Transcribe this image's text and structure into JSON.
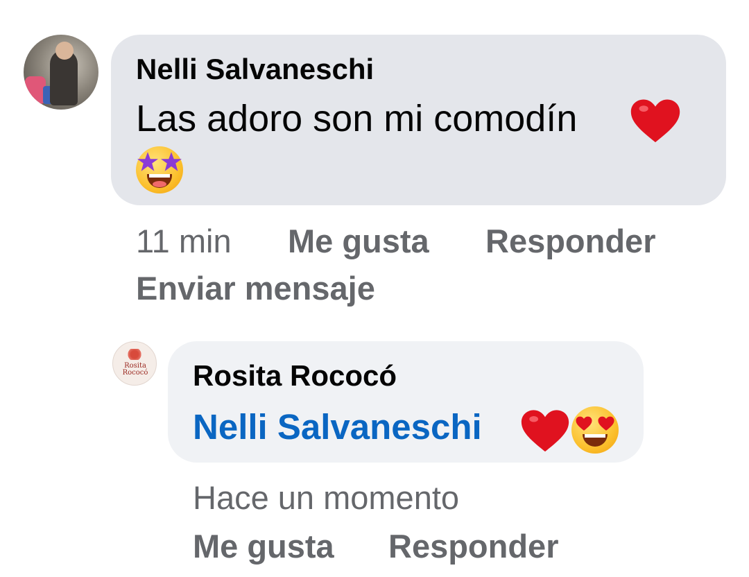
{
  "comment": {
    "author": "Nelli Salvaneschi",
    "text": "Las adoro son mi comodín",
    "emojis": [
      "red-heart-emoji",
      "star-struck-emoji"
    ],
    "time": "11 min",
    "like_label": "Me gusta",
    "reply_label": "Responder",
    "message_label": "Enviar mensaje"
  },
  "reply": {
    "author": "Rosita Rococó",
    "mention": "Nelli Salvaneschi",
    "emojis": [
      "red-heart-emoji",
      "heart-eyes-emoji"
    ],
    "time": "Hace un momento",
    "like_label": "Me gusta",
    "reply_label": "Responder",
    "avatar_text": [
      "Rosita",
      "Rococó"
    ]
  },
  "colors": {
    "bubble_primary": "#e4e6eb",
    "bubble_reply": "#f0f2f5",
    "mention": "#0a66c2",
    "meta": "#65676b"
  }
}
